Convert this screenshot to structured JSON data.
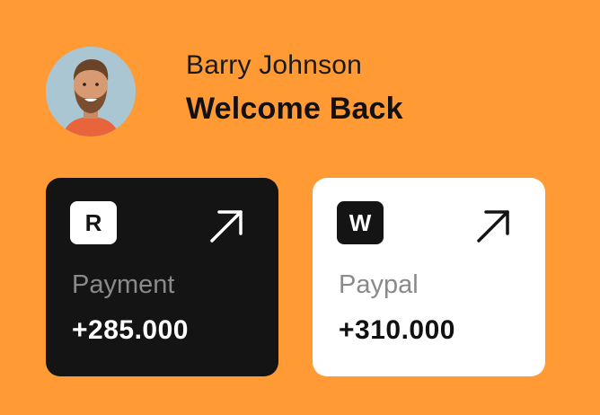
{
  "user": {
    "name": "Barry Johnson",
    "greeting": "Welcome Back"
  },
  "cards": [
    {
      "badge": "R",
      "label": "Payment",
      "value": "+285.000",
      "icon": "arrow-up-right-icon",
      "theme": "dark"
    },
    {
      "badge": "W",
      "label": "Paypal",
      "value": "+310.000",
      "icon": "arrow-up-right-icon",
      "theme": "light"
    }
  ],
  "colors": {
    "background": "#FF9A35",
    "card_dark": "#141414",
    "card_light": "#FFFFFF",
    "label_muted": "#8A8A8A"
  }
}
